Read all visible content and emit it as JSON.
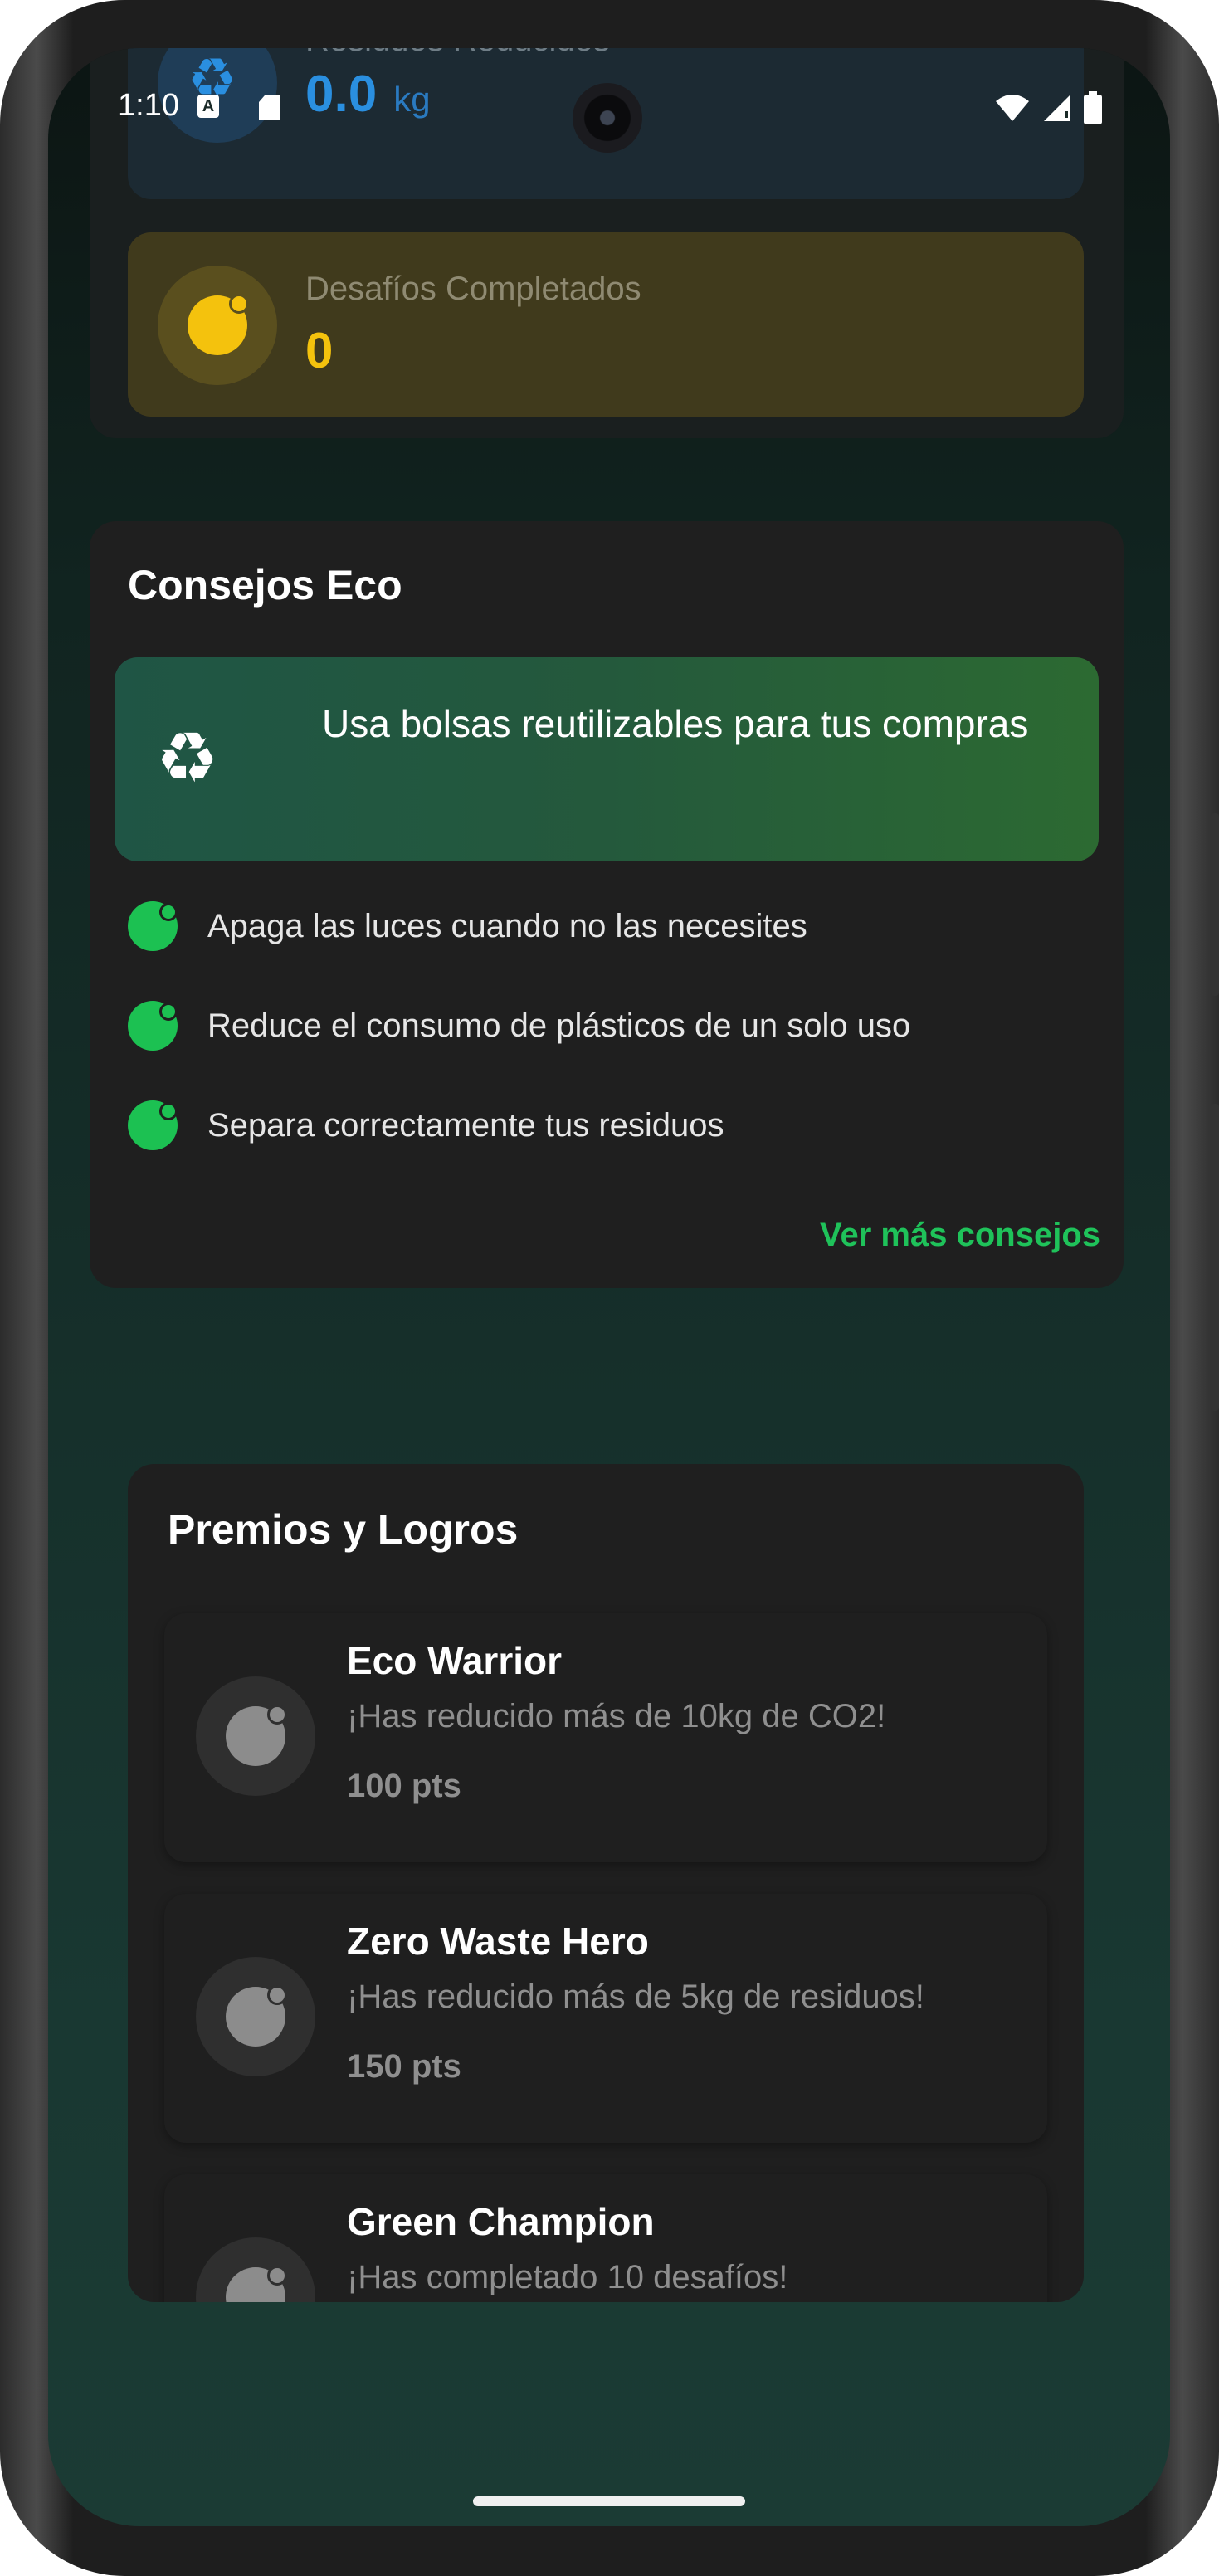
{
  "status_bar": {
    "time": "1:10",
    "icons": [
      "accessibility-a-icon",
      "sd-card-icon",
      "wifi-icon",
      "signal-icon",
      "battery-icon"
    ]
  },
  "stats": {
    "waste": {
      "label": "Residuos Reducidos",
      "value": "0.0",
      "unit": "kg",
      "icon": "recycle-icon",
      "color": "#2a8fe0"
    },
    "challenges": {
      "label": "Desafíos Completados",
      "value": "0",
      "icon": "badge-icon",
      "color": "#f4c20d"
    }
  },
  "eco_tips": {
    "title": "Consejos Eco",
    "featured": {
      "icon": "recycle-icon",
      "text": "Usa bolsas reutilizables para tus compras"
    },
    "items": [
      "Apaga las luces cuando no las necesites",
      "Reduce el consumo de plásticos de un solo uso",
      "Separa correctamente tus residuos"
    ],
    "more_link": "Ver más consejos",
    "accent": "#1cc152"
  },
  "awards": {
    "title": "Premios y Logros",
    "items": [
      {
        "title": "Eco Warrior",
        "description": "¡Has reducido más de 10kg de CO2!",
        "points": "100 pts"
      },
      {
        "title": "Zero Waste Hero",
        "description": "¡Has reducido más de 5kg de residuos!",
        "points": "150 pts"
      },
      {
        "title": "Green Champion",
        "description": "¡Has completado 10 desafíos!",
        "points": ""
      }
    ]
  }
}
